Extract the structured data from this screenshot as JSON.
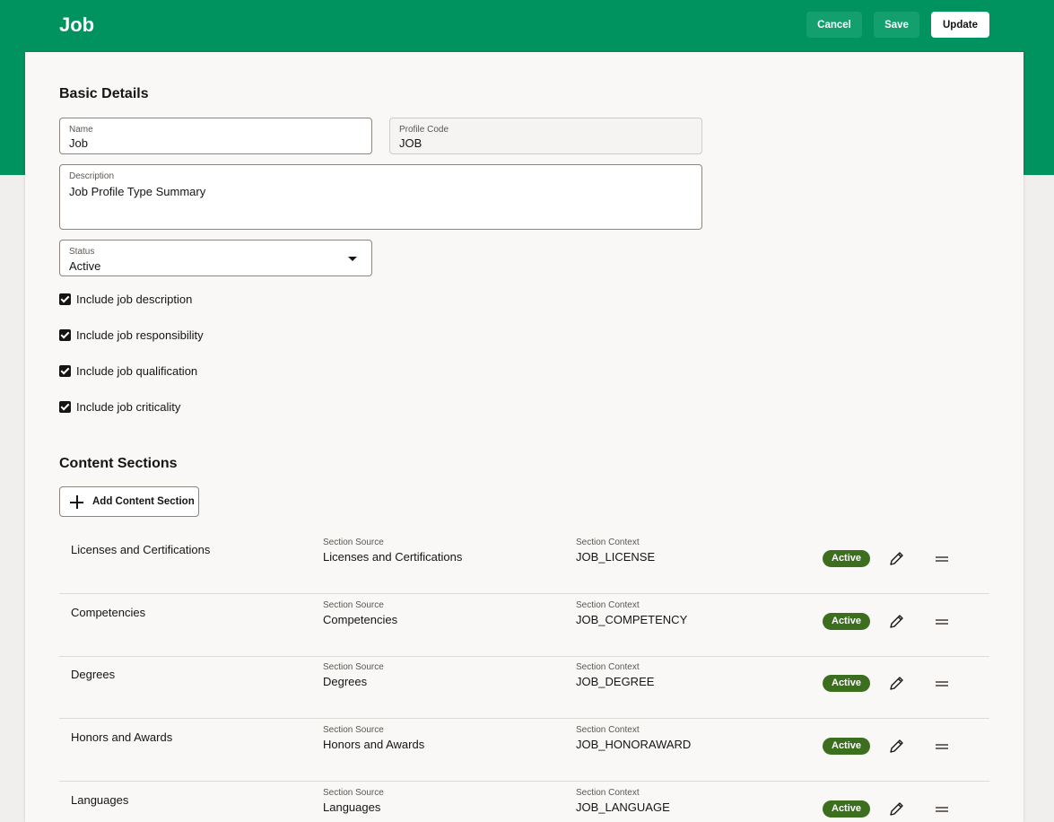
{
  "header": {
    "title": "Job",
    "cancel_label": "Cancel",
    "save_label": "Save",
    "update_label": "Update",
    "background_color": "#00935f"
  },
  "basic_details": {
    "heading": "Basic Details",
    "name": {
      "label": "Name",
      "value": "Job"
    },
    "profile_code": {
      "label": "Profile Code",
      "value": "JOB"
    },
    "description": {
      "label": "Description",
      "value": "Job Profile Type Summary"
    },
    "status": {
      "label": "Status",
      "value": "Active"
    },
    "checkboxes": [
      {
        "label": "Include job description",
        "checked": true
      },
      {
        "label": "Include job responsibility",
        "checked": true
      },
      {
        "label": "Include job qualification",
        "checked": true
      },
      {
        "label": "Include job criticality",
        "checked": true
      }
    ]
  },
  "content_sections": {
    "heading": "Content Sections",
    "add_label": "Add Content Section",
    "source_label": "Section Source",
    "context_label": "Section Context",
    "badge_color": "#3c6e20",
    "items": [
      {
        "name": "Licenses and Certifications",
        "source": "Licenses and Certifications",
        "context": "JOB_LICENSE",
        "status": "Active"
      },
      {
        "name": "Competencies",
        "source": "Competencies",
        "context": "JOB_COMPETENCY",
        "status": "Active"
      },
      {
        "name": "Degrees",
        "source": "Degrees",
        "context": "JOB_DEGREE",
        "status": "Active"
      },
      {
        "name": "Honors and Awards",
        "source": "Honors and Awards",
        "context": "JOB_HONORAWARD",
        "status": "Active"
      },
      {
        "name": "Languages",
        "source": "Languages",
        "context": "JOB_LANGUAGE",
        "status": "Active"
      }
    ]
  }
}
